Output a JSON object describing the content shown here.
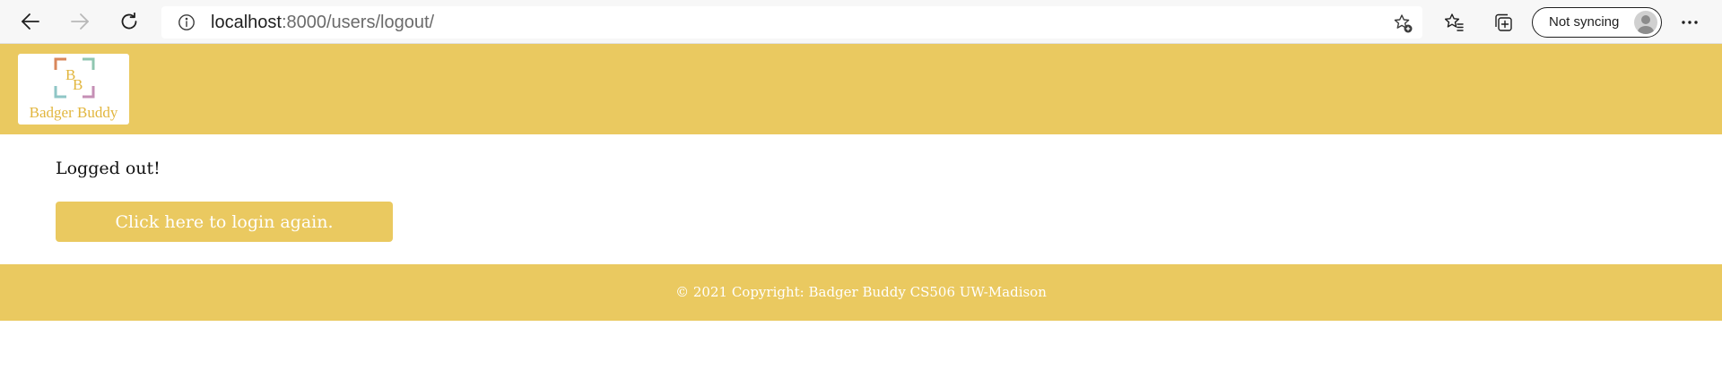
{
  "browser": {
    "url_host": "localhost",
    "url_path": ":8000/users/logout/",
    "sync_label": "Not syncing",
    "icons": {
      "back": "arrow-left-icon",
      "forward": "arrow-right-icon",
      "refresh": "refresh-icon",
      "info": "info-icon",
      "add_favorite": "star-add-icon",
      "favorites": "favorites-icon",
      "collections": "collections-icon",
      "more": "more-icon"
    }
  },
  "header": {
    "logo_monogram": "BB",
    "logo_text": "Badger Buddy",
    "background_color": "#eac960"
  },
  "main": {
    "status_text": "Logged out!",
    "login_button_label": "Click here to login again."
  },
  "footer": {
    "copyright_text": "© 2021 Copyright: Badger Buddy CS506 UW-Madison"
  },
  "colors": {
    "brand": "#eac960",
    "logo_text": "#e2b63e",
    "button_text": "#ffffff"
  }
}
